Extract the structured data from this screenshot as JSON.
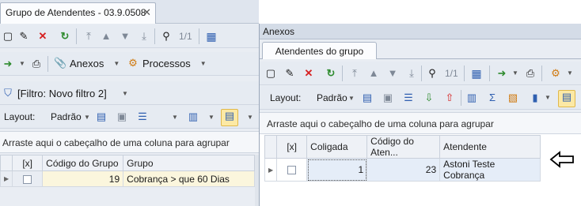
{
  "left_window": {
    "tab_title": "Grupo de Atendentes - 03.9.0508",
    "close_symbol": "✕",
    "record_counter": "1/1",
    "annexes_label": "Anexos",
    "processes_label": "Processos",
    "filter_label": "[Filtro: Novo filtro 2]",
    "layout_label": "Layout:",
    "layout_value": "Padrão",
    "group_hint": "Arraste aqui o cabeçalho de uma coluna para agrupar",
    "columns": [
      "[x]",
      "Código do Grupo",
      "Grupo"
    ],
    "rows": [
      {
        "code": "19",
        "group": "Cobrança > que 60 Dias"
      }
    ]
  },
  "right_panel": {
    "title": "Anexos",
    "tab_label": "Atendentes do grupo",
    "record_counter": "1/1",
    "layout_label": "Layout:",
    "layout_value": "Padrão",
    "group_hint": "Arraste aqui o cabeçalho de uma coluna para agrupar",
    "columns": [
      "[x]",
      "Coligada",
      "Código do Aten...",
      "Atendente"
    ],
    "rows": [
      {
        "coligada": "1",
        "codigo": "23",
        "atendente": "Astoni Teste Cobrança"
      }
    ]
  },
  "icons": {
    "new": "new-icon",
    "edit": "edit-icon",
    "delete": "delete-icon",
    "refresh": "refresh-icon",
    "first": "first-record-icon",
    "prev": "previous-record-icon",
    "next": "next-record-icon",
    "last": "last-record-icon",
    "search": "binoculars-icon",
    "calendar": "grid-view-icon",
    "arrow": "pointer-arrow-icon"
  }
}
